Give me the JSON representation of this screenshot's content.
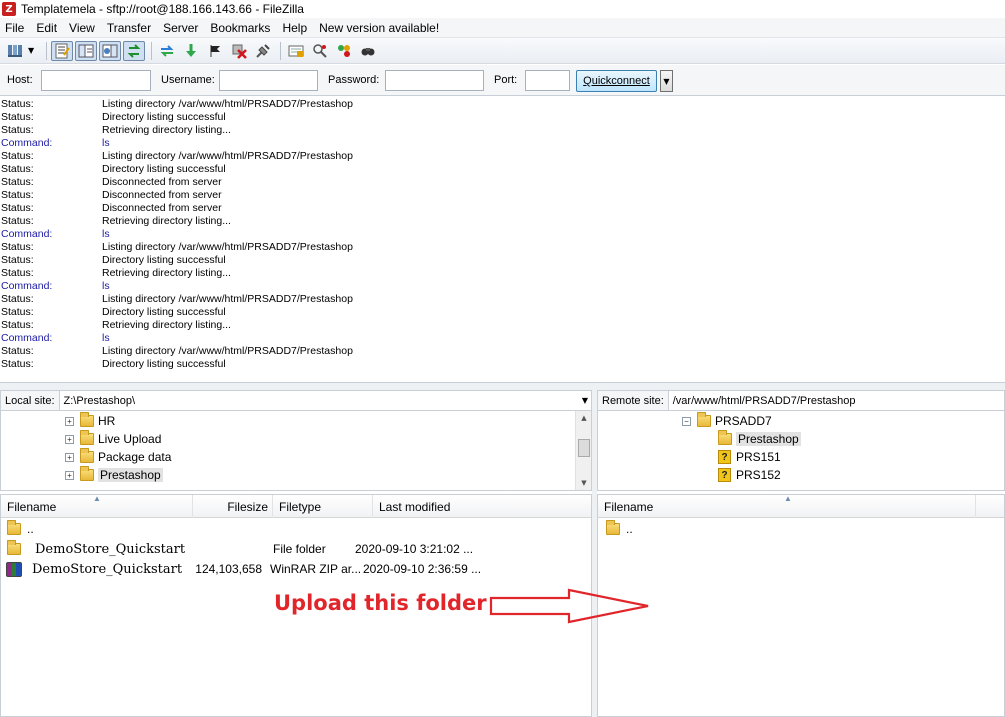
{
  "window": {
    "title": "Templatemela - sftp://root@188.166.143.66 - FileZilla",
    "app_icon": "filezilla-icon"
  },
  "menu": [
    "File",
    "Edit",
    "View",
    "Transfer",
    "Server",
    "Bookmarks",
    "Help",
    "New version available!"
  ],
  "toolbar": {
    "icons": [
      "site-manager-icon",
      "dropdown-icon",
      "toggle-log-icon",
      "toggle-local-tree-icon",
      "toggle-remote-tree-icon",
      "toggle-queue-icon",
      "refresh-icon",
      "process-queue-icon",
      "cancel-icon",
      "cancel-all-icon",
      "disconnect-icon",
      "filter-icon",
      "compare-icon",
      "sync-browse-icon",
      "search-icon"
    ]
  },
  "quickconnect": {
    "host_label": "Host:",
    "host_value": "",
    "username_label": "Username:",
    "username_value": "",
    "password_label": "Password:",
    "password_value": "",
    "port_label": "Port:",
    "port_value": "",
    "button_label": "Quickconnect"
  },
  "log": [
    {
      "type": "Status:",
      "msg": "Listing directory /var/www/html/PRSADD7/Prestashop",
      "kind": "status"
    },
    {
      "type": "Status:",
      "msg": "Directory listing successful",
      "kind": "status"
    },
    {
      "type": "Status:",
      "msg": "Retrieving directory listing...",
      "kind": "status"
    },
    {
      "type": "Command:",
      "msg": "ls",
      "kind": "cmd"
    },
    {
      "type": "Status:",
      "msg": "Listing directory /var/www/html/PRSADD7/Prestashop",
      "kind": "status"
    },
    {
      "type": "Status:",
      "msg": "Directory listing successful",
      "kind": "status"
    },
    {
      "type": "Status:",
      "msg": "Disconnected from server",
      "kind": "status"
    },
    {
      "type": "Status:",
      "msg": "Disconnected from server",
      "kind": "status"
    },
    {
      "type": "Status:",
      "msg": "Disconnected from server",
      "kind": "status"
    },
    {
      "type": "Status:",
      "msg": "Retrieving directory listing...",
      "kind": "status"
    },
    {
      "type": "Command:",
      "msg": "ls",
      "kind": "cmd"
    },
    {
      "type": "Status:",
      "msg": "Listing directory /var/www/html/PRSADD7/Prestashop",
      "kind": "status"
    },
    {
      "type": "Status:",
      "msg": "Directory listing successful",
      "kind": "status"
    },
    {
      "type": "Status:",
      "msg": "Retrieving directory listing...",
      "kind": "status"
    },
    {
      "type": "Command:",
      "msg": "ls",
      "kind": "cmd"
    },
    {
      "type": "Status:",
      "msg": "Listing directory /var/www/html/PRSADD7/Prestashop",
      "kind": "status"
    },
    {
      "type": "Status:",
      "msg": "Directory listing successful",
      "kind": "status"
    },
    {
      "type": "Status:",
      "msg": "Retrieving directory listing...",
      "kind": "status"
    },
    {
      "type": "Command:",
      "msg": "ls",
      "kind": "cmd"
    },
    {
      "type": "Status:",
      "msg": "Listing directory /var/www/html/PRSADD7/Prestashop",
      "kind": "status"
    },
    {
      "type": "Status:",
      "msg": "Directory listing successful",
      "kind": "status"
    }
  ],
  "local": {
    "label": "Local site:",
    "path": "Z:\\Prestashop\\",
    "tree": [
      {
        "name": "HR"
      },
      {
        "name": "Live Upload"
      },
      {
        "name": "Package data"
      },
      {
        "name": "Prestashop"
      }
    ],
    "columns": [
      "Filename",
      "Filesize",
      "Filetype",
      "Last modified"
    ],
    "files": [
      {
        "name": "..",
        "size": "",
        "type": "",
        "modified": "",
        "icon": "folder-icon"
      },
      {
        "name": "DemoStore_Quickstart",
        "size": "",
        "type": "File folder",
        "modified": "2020-09-10 3:21:02 ...",
        "icon": "folder-icon"
      },
      {
        "name": "DemoStore_Quickstart",
        "size": "124,103,658",
        "type": "WinRAR ZIP ar...",
        "modified": "2020-09-10 2:36:59 ...",
        "icon": "winrar-archive-icon"
      }
    ]
  },
  "remote": {
    "label": "Remote site:",
    "path": "/var/www/html/PRSADD7/Prestashop",
    "tree": [
      {
        "name": "PRSADD7",
        "icon": "folder-icon"
      },
      {
        "name": "Prestashop",
        "icon": "folder-icon"
      },
      {
        "name": "PRS151",
        "icon": "unknown-folder-icon"
      },
      {
        "name": "PRS152",
        "icon": "unknown-folder-icon"
      }
    ],
    "columns": [
      "Filename"
    ],
    "files": [
      {
        "name": "..",
        "icon": "folder-icon"
      }
    ]
  },
  "annotation": {
    "text": "Upload this folder",
    "color": "#e1262b"
  }
}
